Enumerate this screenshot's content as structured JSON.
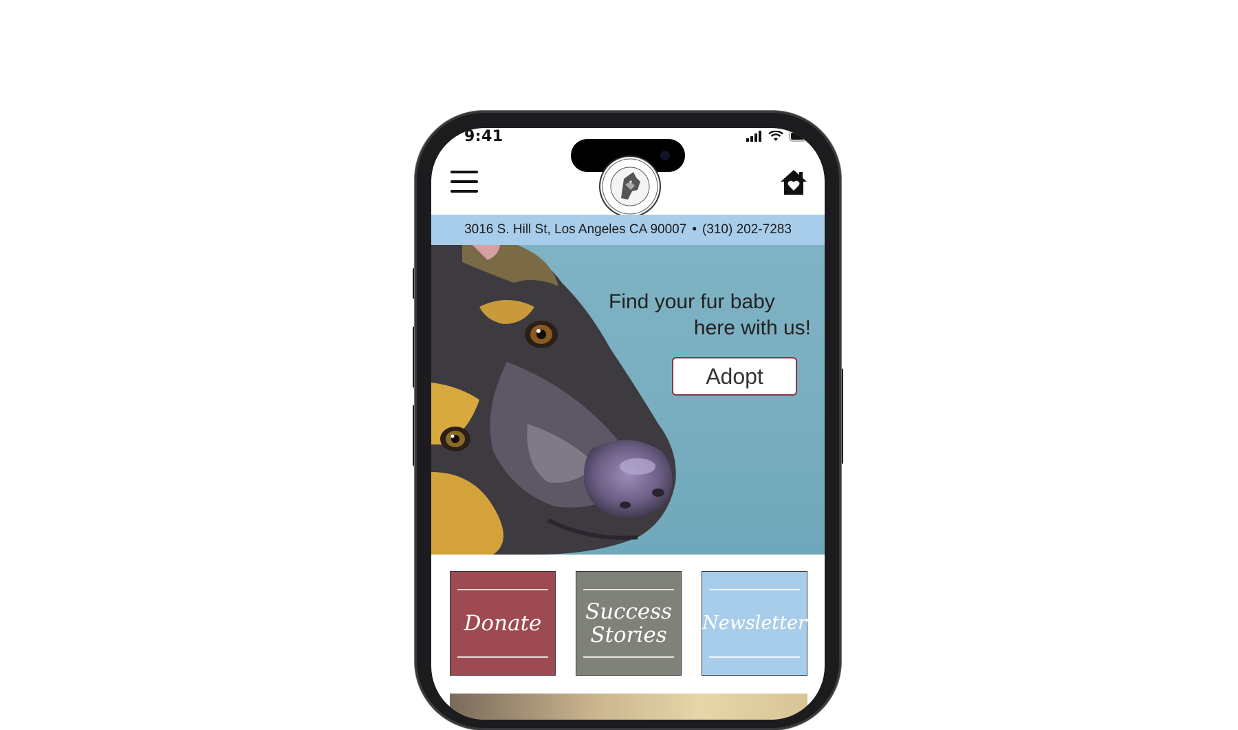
{
  "status_bar": {
    "time": "9:41"
  },
  "header": {
    "logo_icon": "shelter-logo-icon",
    "menu_icon": "hamburger-menu-icon",
    "home_icon": "home-heart-icon"
  },
  "address_bar": {
    "address": "3016 S. Hill St, Los Angeles CA 90007",
    "separator": "•",
    "phone": "(310) 202-7283",
    "background": "#a8cdea"
  },
  "hero": {
    "title_line1": "Find your fur baby",
    "title_line2": "here with us!",
    "adopt_label": "Adopt",
    "background": "#7fb3c4"
  },
  "tiles": [
    {
      "label_line1": "Donate",
      "label_line2": "",
      "color": "#9e4a52"
    },
    {
      "label_line1": "Success",
      "label_line2": "Stories",
      "color": "#7f8279"
    },
    {
      "label_line1": "Newsletter",
      "label_line2": "",
      "color": "#a8cdea"
    }
  ]
}
